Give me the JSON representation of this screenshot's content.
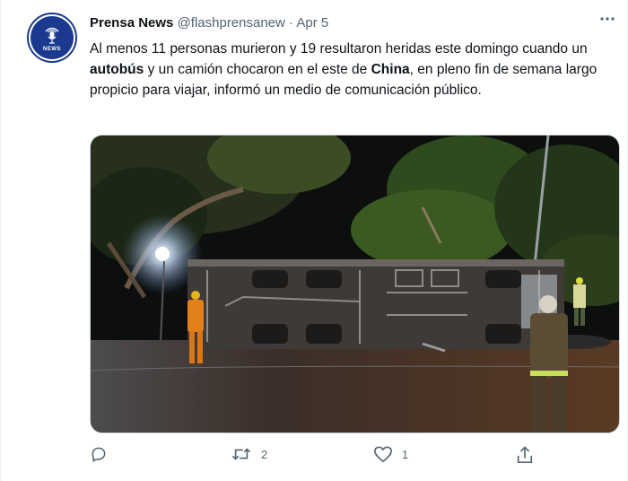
{
  "tweet": {
    "display_name": "Prensa News",
    "handle": "@flashprensanew",
    "separator": "·",
    "date": "Apr 5",
    "avatar_label": "NEWS",
    "text_segments": {
      "s1": "Al menos 11 personas murieron y 19 resultaron heridas este domingo cuando un ",
      "b1": "autobús",
      "s2": " y un camión chocaron en el este de ",
      "b2": "China",
      "s3": ", en pleno fin de semana largo propicio para viajar, informó un medio de comunicación público."
    }
  },
  "actions": {
    "reply_count": "",
    "retweet_count": "2",
    "like_count": "1"
  },
  "icons": {
    "more": "more-horizontal-icon",
    "reply": "comment-icon",
    "retweet": "retweet-icon",
    "like": "heart-icon",
    "share": "share-icon",
    "avatar": "microphone-icon"
  },
  "colors": {
    "brand_blue": "#1b3a8f",
    "secondary_text": "#536471",
    "primary_text": "#0f1419"
  }
}
